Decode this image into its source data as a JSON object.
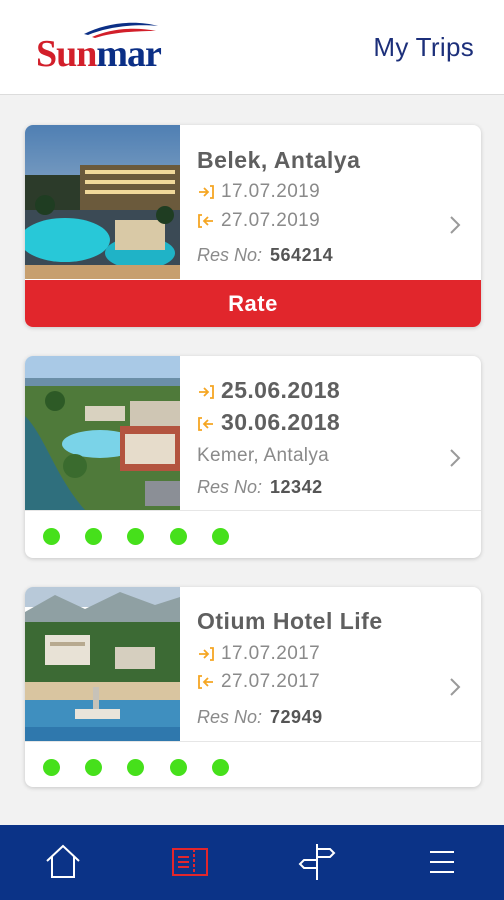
{
  "header": {
    "logo_text_red": "Sun",
    "logo_text_blue": "mar",
    "title": "My Trips"
  },
  "trips": [
    {
      "title": "Belek, Antalya",
      "checkin": "17.07.2019",
      "checkout": "27.07.2019",
      "res_label": "Res No:",
      "res_no": "564214",
      "action_label": "Rate"
    },
    {
      "checkin": "25.06.2018",
      "checkout": "30.06.2018",
      "location": "Kemer, Antalya",
      "res_label": "Res No:",
      "res_no": "12342",
      "rating": 5
    },
    {
      "title": "Otium Hotel Life",
      "checkin": "17.07.2017",
      "checkout": "27.07.2017",
      "res_label": "Res No:",
      "res_no": "72949",
      "rating": 5
    }
  ],
  "tabbar": {
    "items": [
      "home-icon",
      "ticket-icon",
      "signpost-icon",
      "menu-icon"
    ],
    "active_index": 1
  },
  "colors": {
    "brand_red": "#e1262c",
    "brand_blue": "#0b3387",
    "rating_green": "#46e01b",
    "arrow_orange": "#f5a623"
  }
}
